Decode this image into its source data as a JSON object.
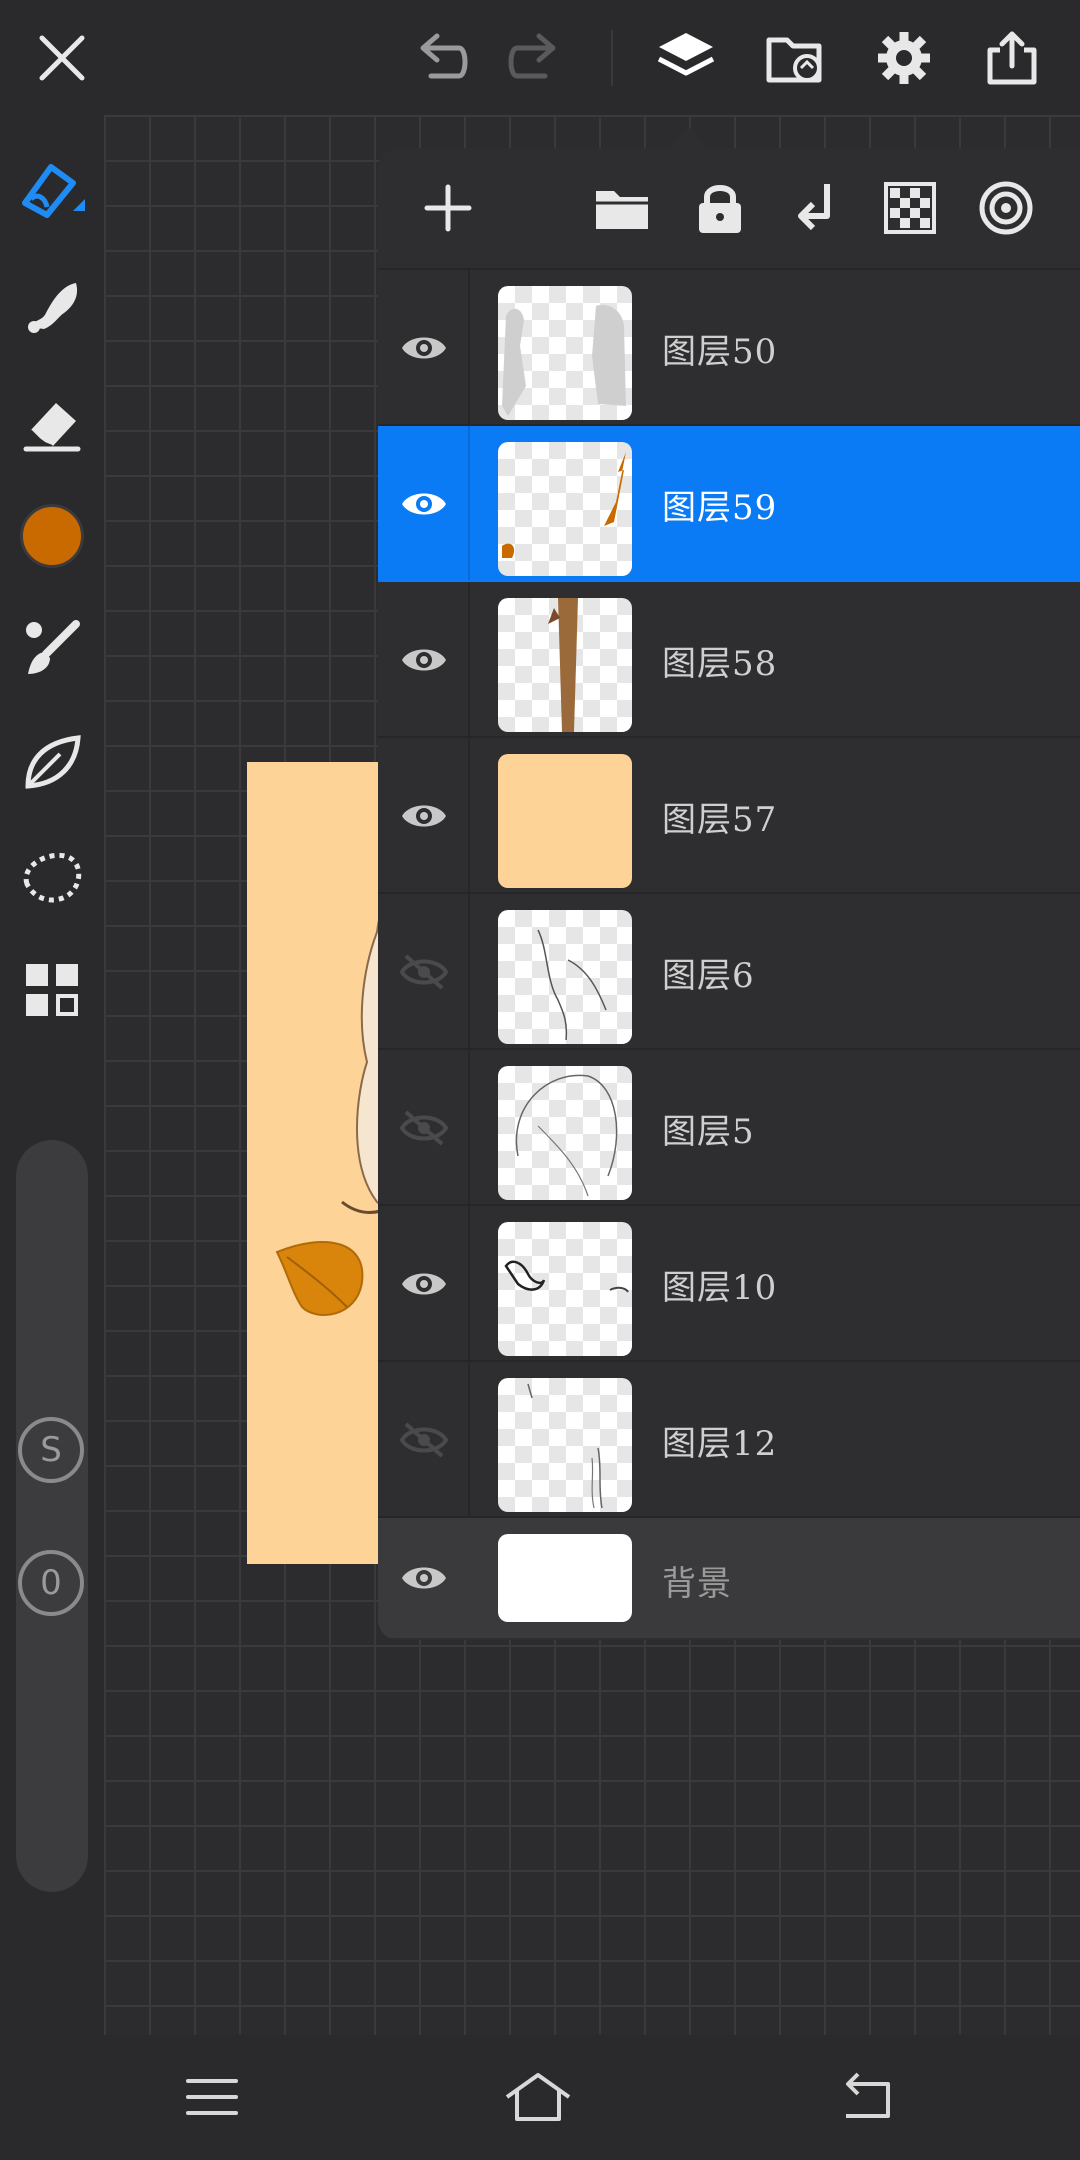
{
  "app": {
    "accent": "#0a7af5",
    "current_color": "#c86a00"
  },
  "top_bar": {
    "icons": [
      "close-icon",
      "undo-icon",
      "redo-icon",
      "layers-icon",
      "import-icon",
      "settings-icon",
      "share-icon"
    ]
  },
  "left_toolbar": {
    "tools": [
      "brush-icon",
      "smudge-icon",
      "eraser-icon",
      "color-swatch",
      "brush-library-icon",
      "leaf-brush-icon",
      "lasso-select-icon",
      "apps-icon"
    ],
    "size_button": "S",
    "opacity_button": "0"
  },
  "layers_panel": {
    "header_icons": [
      "add-layer-icon",
      "folder-icon",
      "lock-icon",
      "merge-down-icon",
      "transparency-icon",
      "layer-settings-icon"
    ],
    "layers": [
      {
        "name": "图层50",
        "visible": true,
        "selected": false
      },
      {
        "name": "图层59",
        "visible": true,
        "selected": true
      },
      {
        "name": "图层58",
        "visible": true,
        "selected": false
      },
      {
        "name": "图层57",
        "visible": true,
        "selected": false
      },
      {
        "name": "图层6",
        "visible": false,
        "selected": false
      },
      {
        "name": "图层5",
        "visible": false,
        "selected": false
      },
      {
        "name": "图层10",
        "visible": true,
        "selected": false
      },
      {
        "name": "图层12",
        "visible": false,
        "selected": false
      }
    ],
    "background_layer": {
      "name": "背景",
      "visible": true
    }
  },
  "bottom_nav": {
    "icons": [
      "menu-icon",
      "home-icon",
      "back-icon"
    ]
  }
}
